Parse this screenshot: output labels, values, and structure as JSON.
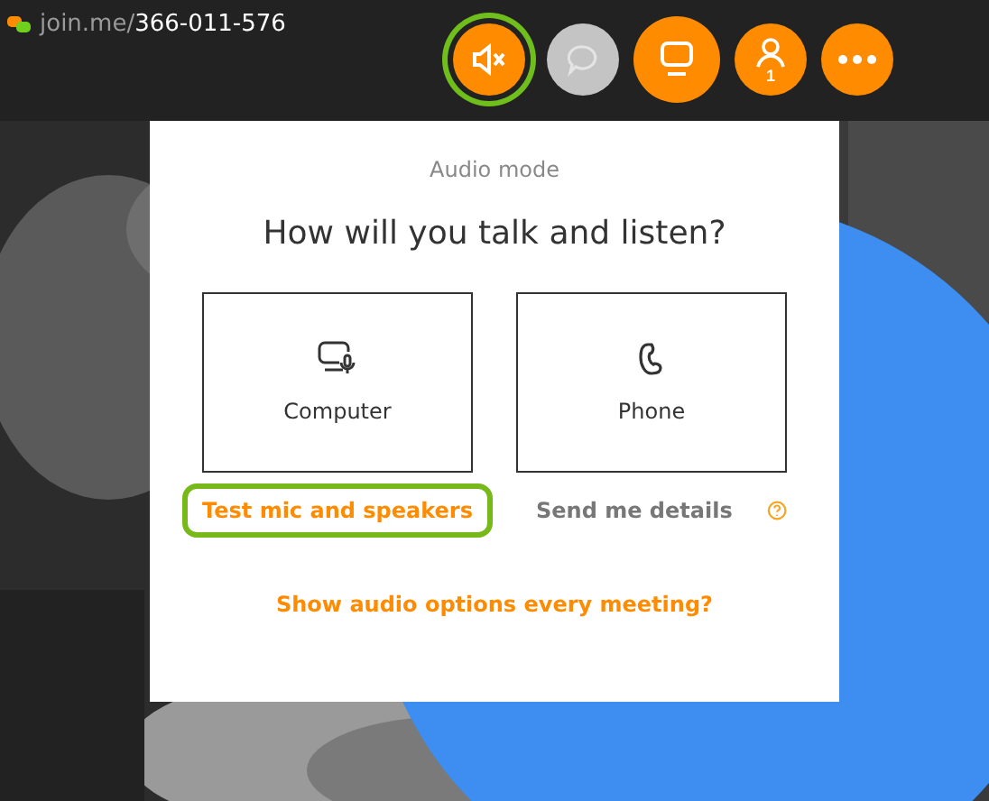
{
  "header": {
    "url_prefix": "join.me/",
    "url_code": "366-011-576"
  },
  "toolbar": [
    {
      "kind": "mute",
      "highlighted": true,
      "disabled": false
    },
    {
      "kind": "chat",
      "highlighted": false,
      "disabled": true
    },
    {
      "kind": "screen",
      "highlighted": false,
      "disabled": false
    },
    {
      "kind": "people",
      "highlighted": false,
      "disabled": false,
      "count": "1"
    },
    {
      "kind": "more",
      "highlighted": false,
      "disabled": false
    }
  ],
  "popup": {
    "caption": "Audio mode",
    "title": "How will you talk and listen?",
    "options": [
      {
        "kind": "computer",
        "label": "Computer"
      },
      {
        "kind": "phone",
        "label": "Phone"
      }
    ],
    "links": [
      {
        "kind": "test",
        "label": "Test mic and speakers",
        "highlighted": true
      },
      {
        "kind": "details",
        "label": "Send me details",
        "highlighted": false
      }
    ],
    "footer_link": "Show audio options every meeting?"
  }
}
